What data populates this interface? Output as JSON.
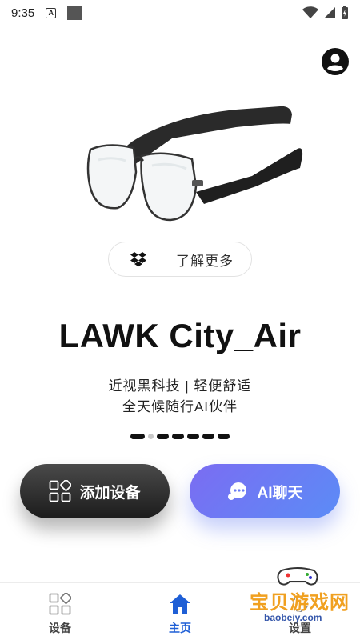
{
  "status_bar": {
    "time": "9:35",
    "a_badge": "A"
  },
  "header": {
    "profile_icon": "account-circle-icon"
  },
  "product": {
    "learn_more_icon": "dropbox-icon",
    "learn_more_label": "了解更多",
    "title": "LAWK City_Air",
    "tagline_1": "近视黑科技 | 轻便舒适",
    "tagline_2": "全天候随行AI伙伴"
  },
  "pager": {
    "count": 7,
    "active_index": 0
  },
  "actions": {
    "add_device_label": "添加设备",
    "ai_chat_label": "AI聊天"
  },
  "bottom_nav": {
    "items": [
      {
        "label": "设备",
        "icon": "devices-grid-icon",
        "active": false
      },
      {
        "label": "主页",
        "icon": "home-icon",
        "active": true
      },
      {
        "label": "设置",
        "icon": "settings-icon",
        "active": false
      }
    ]
  },
  "watermark": {
    "text": "宝贝游戏网",
    "url": "baobeiy.com"
  },
  "colors": {
    "accent": "#1f5fd6",
    "ai_gradient_start": "#7b6cf2",
    "ai_gradient_end": "#5b8cf6",
    "dark_button": "#1c1c1c"
  }
}
